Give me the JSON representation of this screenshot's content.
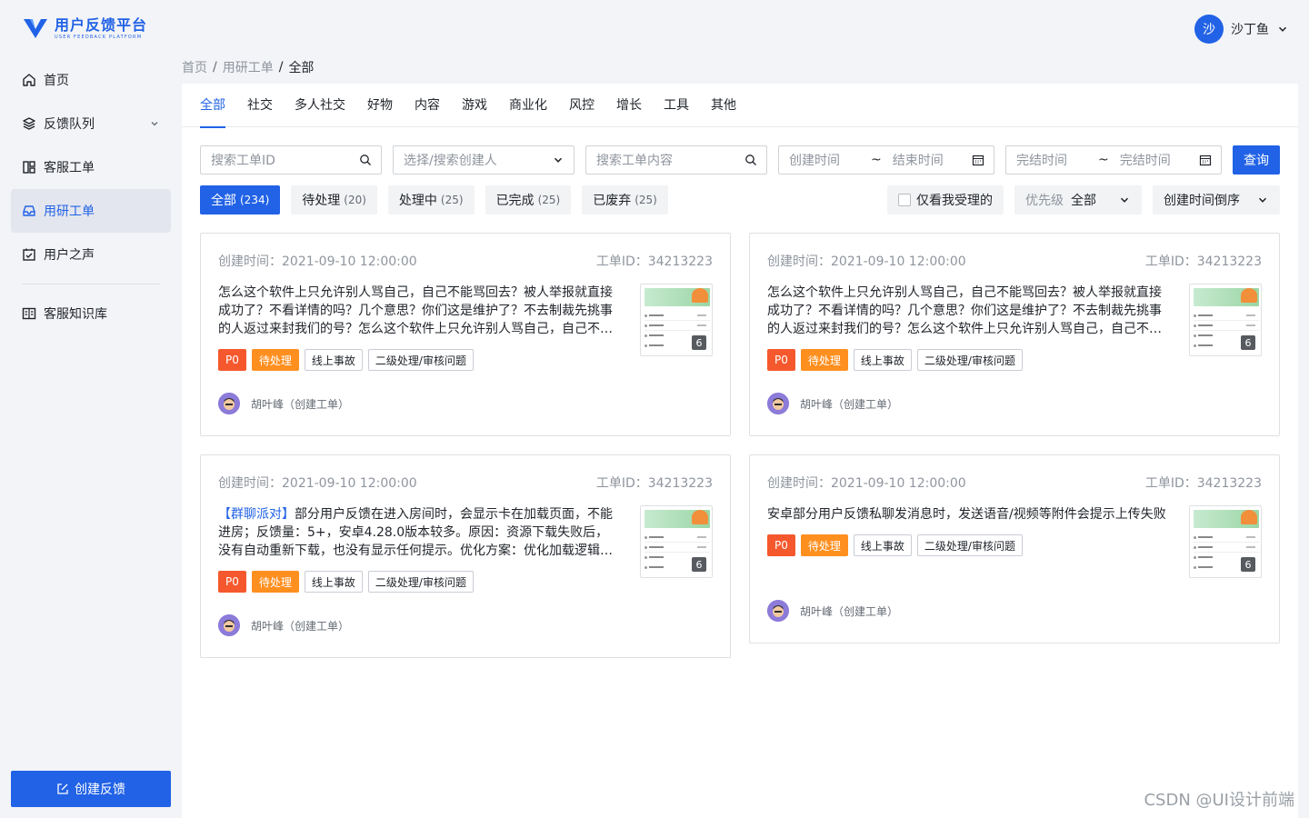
{
  "app": {
    "title": "用户反馈平台",
    "subtitle": "USER FEEDBACK PLATFORM",
    "brand_color": "#2162e6"
  },
  "sidebar": {
    "items": [
      {
        "label": "首页",
        "icon": "home-icon"
      },
      {
        "label": "反馈队列",
        "icon": "layers-icon"
      },
      {
        "label": "客服工单",
        "icon": "grid-icon"
      },
      {
        "label": "用研工单",
        "icon": "inbox-icon"
      },
      {
        "label": "用户之声",
        "icon": "calendar-check-icon"
      },
      {
        "label": "客服知识库",
        "icon": "book-icon"
      }
    ],
    "create_label": "创建反馈"
  },
  "user": {
    "avatar_text": "沙",
    "name": "沙丁鱼"
  },
  "breadcrumb": [
    "首页",
    "用研工单",
    "全部"
  ],
  "tabs": [
    "全部",
    "社交",
    "多人社交",
    "好物",
    "内容",
    "游戏",
    "商业化",
    "风控",
    "增长",
    "工具",
    "其他"
  ],
  "filters": {
    "search_id": "搜索工单ID",
    "creator": "选择/搜索创建人",
    "search_content": "搜索工单内容",
    "create_start": "创建时间",
    "create_end": "结束时间",
    "finish_start": "完结时间",
    "finish_end": "完结时间",
    "tilde": "~",
    "query": "查询"
  },
  "status_tabs": [
    {
      "label": "全部",
      "count": "(234)"
    },
    {
      "label": "待处理",
      "count": "(20)"
    },
    {
      "label": "处理中",
      "count": "(25)"
    },
    {
      "label": "已完成",
      "count": "(25)"
    },
    {
      "label": "已废弃",
      "count": "(25)"
    }
  ],
  "controls": {
    "only_mine": "仅看我受理的",
    "priority_label": "优先级",
    "priority_value": "全部",
    "sort": "创建时间倒序"
  },
  "cards": [
    {
      "created": "创建时间：2021-09-10 12:00:00",
      "ticket_id": "工单ID：34213223",
      "highlight": "",
      "desc": "怎么这个软件上只允许别人骂自己，自己不能骂回去？被人举报就直接成功了？不看详情的吗？几个意思？你们这是维护了？不去制裁先挑事的人返过来封我们的号？怎么这个软件上只允许别人骂自己，自己不…",
      "tags": [
        "P0",
        "待处理",
        "线上事故",
        "二级处理/审核问题"
      ],
      "creator": "胡叶峰（创建工单）",
      "image_count": "6"
    },
    {
      "created": "创建时间：2021-09-10 12:00:00",
      "ticket_id": "工单ID：34213223",
      "highlight": "",
      "desc": "怎么这个软件上只允许别人骂自己，自己不能骂回去？被人举报就直接成功了？不看详情的吗？几个意思？你们这是维护了？不去制裁先挑事的人返过来封我们的号？怎么这个软件上只允许别人骂自己，自己不…",
      "tags": [
        "P0",
        "待处理",
        "线上事故",
        "二级处理/审核问题"
      ],
      "creator": "胡叶峰（创建工单）",
      "image_count": "6"
    },
    {
      "created": "创建时间：2021-09-10 12:00:00",
      "ticket_id": "工单ID：34213223",
      "highlight": "【群聊派对】",
      "desc": "部分用户反馈在进入房间时，会显示卡在加载页面，不能进房；反馈量：5+，安卓4.28.0版本较多。原因：资源下载失败后，没有自动重新下载，也没有显示任何提示。优化方案：优化加载逻辑…",
      "tags": [
        "P0",
        "待处理",
        "线上事故",
        "二级处理/审核问题"
      ],
      "creator": "胡叶峰（创建工单）",
      "image_count": "6"
    },
    {
      "created": "创建时间：2021-09-10 12:00:00",
      "ticket_id": "工单ID：34213223",
      "highlight": "",
      "desc": "安卓部分用户反馈私聊发消息时，发送语音/视频等附件会提示上传失败",
      "tags": [
        "P0",
        "待处理",
        "线上事故",
        "二级处理/审核问题"
      ],
      "creator": "胡叶峰（创建工单）",
      "image_count": "6"
    }
  ],
  "watermark": "CSDN @UI设计前端"
}
